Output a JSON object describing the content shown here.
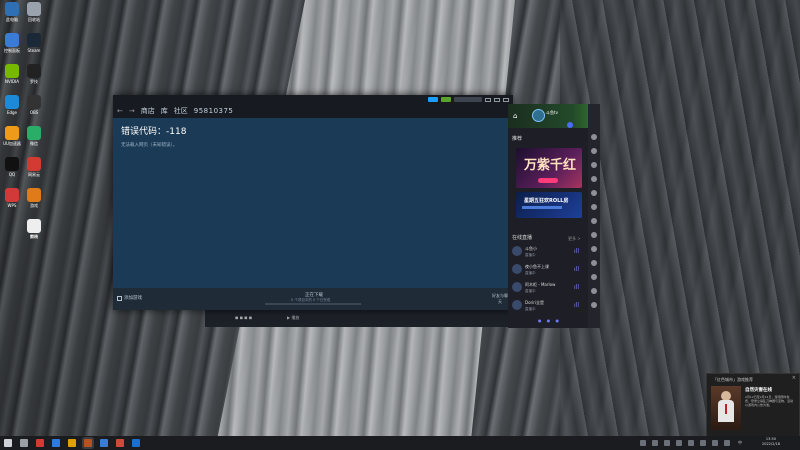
{
  "desktop": {
    "icons": [
      {
        "label": "此电脑",
        "color": "#2f6fb3"
      },
      {
        "label": "回收站",
        "color": "#9aa3ad"
      },
      {
        "label": "控制面板",
        "color": "#3a7bd5"
      },
      {
        "label": "Steam",
        "color": "#1b2838"
      },
      {
        "label": "NVIDIA",
        "color": "#76b900"
      },
      {
        "label": "罗技",
        "color": "#222"
      },
      {
        "label": "Edge",
        "color": "#1c8ad8"
      },
      {
        "label": "OBS",
        "color": "#333"
      },
      {
        "label": "UU加速器",
        "color": "#f09a1a"
      },
      {
        "label": "微信",
        "color": "#2aae67"
      },
      {
        "label": "QQ",
        "color": "#111"
      },
      {
        "label": "网易云",
        "color": "#d33a31"
      },
      {
        "label": "WPS",
        "color": "#d23a3a"
      },
      {
        "label": "游戏",
        "color": "#e07b1a"
      },
      {
        "label": "腾讯",
        "color": "#2e7be0"
      },
      {
        "label": "剪映",
        "color": "#eee"
      }
    ]
  },
  "steam": {
    "nav": {
      "back": "←",
      "forward": "→",
      "store": "商店",
      "library": "库",
      "community": "社区",
      "user": "95810375"
    },
    "error_code": "错误代码：-118",
    "error_message": "无法载入网页（未知错误）。",
    "status": {
      "add_game": "添加游戏",
      "downloads": "正在下载",
      "downloads_sub": "0 个项目中的 0 个已完成",
      "friends_chat": "好友与聊天"
    }
  },
  "side_app": {
    "user": "斗鱼tv",
    "section": "推荐",
    "banner1_title": "万紫千红",
    "banner2_title": "星期五狂欢ROLL房",
    "live_header": "在线直播",
    "live_more": "更多 >",
    "streamers": [
      {
        "name": "斗鱼小",
        "status": "直播中"
      },
      {
        "name": "夜小鱼不上课",
        "status": "直播中"
      },
      {
        "name": "阿木柜 - Marlow",
        "status": "直播中"
      },
      {
        "name": "Doriri全是",
        "status": "直播中"
      }
    ]
  },
  "video_strip": {
    "play": "▶ 播放",
    "controls": "◼ ◼ ◼ ◼"
  },
  "notification": {
    "header": "「红色城市」游戏推荐",
    "title": "自然灾害在线",
    "body": "2月12日至2月14日，游戏限时免费，登录立得乱刀神器与宝物，活动以游戏内公告为准。",
    "close": "×"
  },
  "taskbar": {
    "time": "13:50",
    "date": "2022/2/18",
    "lang": "中"
  }
}
